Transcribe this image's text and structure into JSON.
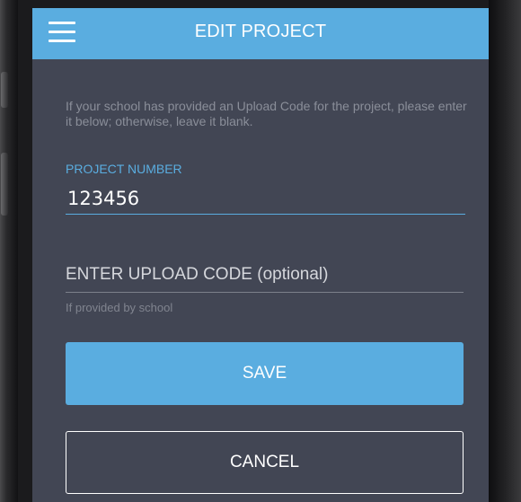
{
  "header": {
    "title": "EDIT PROJECT",
    "menu_icon": "hamburger-menu-icon",
    "background_color": "#5aade0"
  },
  "form": {
    "intro_text": "If your school has provided an Upload Code for the project, please enter it below; otherwise, leave it blank.",
    "project_number": {
      "label": "PROJECT NUMBER",
      "value": "123456"
    },
    "upload_code": {
      "placeholder": "ENTER UPLOAD CODE (optional)",
      "value": "",
      "helper": "If provided by school"
    }
  },
  "actions": {
    "save_label": "SAVE",
    "cancel_label": "CANCEL"
  },
  "colors": {
    "accent": "#5aade0",
    "screen_background": "#424654"
  }
}
